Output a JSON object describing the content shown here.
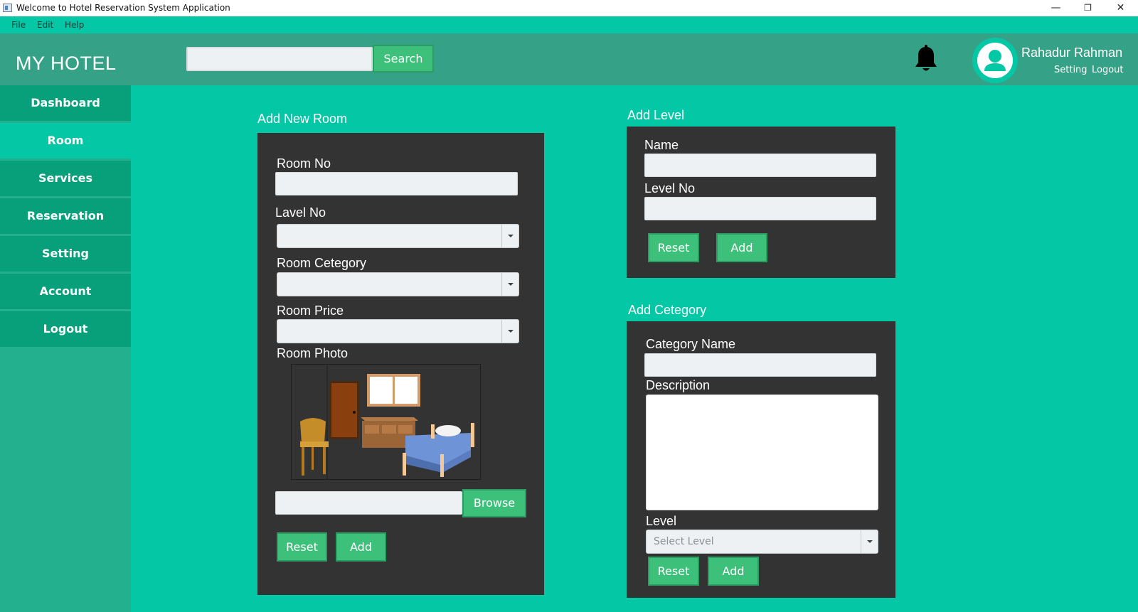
{
  "window": {
    "title": "Welcome to Hotel Reservation System Application",
    "min": "—",
    "max": "❐",
    "close": "✕"
  },
  "menu": [
    "File",
    "Edit",
    "Help"
  ],
  "header": {
    "brand": "MY HOTEL",
    "search_value": "",
    "search_button": "Search",
    "user_name": "Rahadur Rahman",
    "setting_link": "Setting",
    "logout_link": "Logout"
  },
  "sidebar": {
    "items": [
      {
        "label": "Dashboard"
      },
      {
        "label": "Room"
      },
      {
        "label": "Services"
      },
      {
        "label": "Reservation"
      },
      {
        "label": "Setting"
      },
      {
        "label": "Account"
      },
      {
        "label": "Logout"
      }
    ],
    "active": "Room"
  },
  "add_room": {
    "title": "Add New Room",
    "room_no_label": "Room No",
    "room_no_value": "",
    "level_label": "Lavel No",
    "level_value": "",
    "category_label": "Room Cetegory",
    "category_value": "",
    "price_label": "Room Price",
    "price_value": "",
    "photo_label": "Room Photo",
    "photo_path": "",
    "browse_button": "Browse",
    "reset_button": "Reset",
    "add_button": "Add"
  },
  "add_level": {
    "title": "Add Level",
    "name_label": "Name",
    "name_value": "",
    "level_no_label": "Level No",
    "level_no_value": "",
    "reset_button": "Reset",
    "add_button": "Add"
  },
  "add_category": {
    "title": "Add Cetegory",
    "name_label": "Category Name",
    "name_value": "",
    "description_label": "Description",
    "description_value": "",
    "level_label": "Level",
    "level_placeholder": "Select Level",
    "reset_button": "Reset",
    "add_button": "Add"
  },
  "colors": {
    "teal_bg": "#04c7a6",
    "header_bg": "#35a287",
    "nav_bg": "#07a07b",
    "panel_bg": "#333333",
    "button_green": "#3cc07a"
  },
  "icons": {
    "bell": "bell-icon",
    "avatar": "user-avatar-icon",
    "dropdown": "chevron-down-icon"
  }
}
